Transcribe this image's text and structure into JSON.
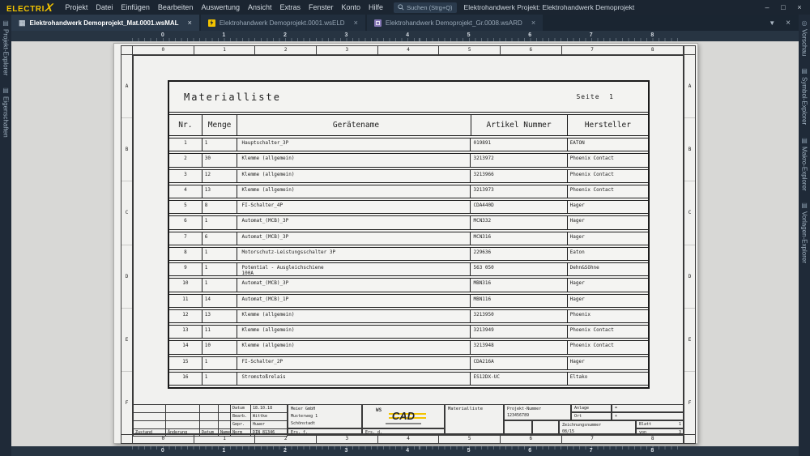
{
  "titlebar": {
    "logo_main": "ELECTRI",
    "logo_x": "X",
    "menus": [
      "Projekt",
      "Datei",
      "Einfügen",
      "Bearbeiten",
      "Auswertung",
      "Ansicht",
      "Extras",
      "Fenster",
      "Konto",
      "Hilfe"
    ],
    "search_placeholder": "Suchen (Strg+Q)",
    "window_title": "Elektrohandwerk  Projekt: Elektrohandwerk Demoprojekt",
    "minimize": "–",
    "maximize": "□",
    "close": "×"
  },
  "tabbar": {
    "tabs": [
      {
        "label": "Elektrohandwerk Demoprojekt_Mat.0001.wsMAL"
      },
      {
        "label": "Elektrohandwerk Demoprojekt.0001.wsELD"
      },
      {
        "label": "Elektrohandwerk Demoprojekt_Gr.0008.wsARD"
      }
    ],
    "close_glyph": "×",
    "dropdown_glyph": "▼"
  },
  "left_rail": {
    "items": [
      {
        "label": "Projekt-Explorer"
      },
      {
        "label": "Eigenschaften"
      }
    ]
  },
  "right_rail": {
    "items": [
      {
        "label": "Vorschau"
      },
      {
        "label": "Symbol-Explorer"
      },
      {
        "label": "Makro-Explorer"
      },
      {
        "label": "Vorlagen-Explorer"
      }
    ]
  },
  "rulers": {
    "numbers": [
      "0",
      "1",
      "2",
      "3",
      "4",
      "5",
      "6",
      "7",
      "8"
    ],
    "letters": [
      "A",
      "B",
      "C",
      "D",
      "E",
      "F"
    ]
  },
  "document": {
    "title": "Materialliste",
    "page_label": "Seite",
    "page_number": "1",
    "columns": [
      "Nr.",
      "Menge",
      "Gerätename",
      "Artikel Nummer",
      "Hersteller"
    ],
    "rows": [
      {
        "nr": "1",
        "menge": "1",
        "name": "Hauptschalter_3P",
        "name2": "",
        "artikel": "019891",
        "hersteller": "EATON"
      },
      {
        "nr": "2",
        "menge": "30",
        "name": "Klemme (allgemein)",
        "name2": "",
        "artikel": "3213972",
        "hersteller": "Phoenix Contact"
      },
      {
        "nr": "3",
        "menge": "12",
        "name": "Klemme (allgemein)",
        "name2": "",
        "artikel": "3213966",
        "hersteller": "Phoenix Contact"
      },
      {
        "nr": "4",
        "menge": "13",
        "name": "Klemme (allgemein)",
        "name2": "",
        "artikel": "3213973",
        "hersteller": "Phoenix Contact"
      },
      {
        "nr": "5",
        "menge": "8",
        "name": "FI-Schalter_4P",
        "name2": "",
        "artikel": "CDA440D",
        "hersteller": "Hager"
      },
      {
        "nr": "6",
        "menge": "1",
        "name": "Automat_(MCB)_3P",
        "name2": "",
        "artikel": "MCN332",
        "hersteller": "Hager"
      },
      {
        "nr": "7",
        "menge": "6",
        "name": "Automat_(MCB)_3P",
        "name2": "",
        "artikel": "MCN316",
        "hersteller": "Hager"
      },
      {
        "nr": "8",
        "menge": "1",
        "name": "Motorschutz-Leistungsschalter 3P",
        "name2": "",
        "artikel": "229636",
        "hersteller": "Eaton"
      },
      {
        "nr": "9",
        "menge": "1",
        "name": "Potential - Ausgleichschiene",
        "name2": "100A",
        "artikel": "563 050",
        "hersteller": "Dehn&Söhne"
      },
      {
        "nr": "10",
        "menge": "1",
        "name": "Automat_(MCB)_3P",
        "name2": "",
        "artikel": "MBN316",
        "hersteller": "Hager"
      },
      {
        "nr": "11",
        "menge": "14",
        "name": "Automat_(MCB)_1P",
        "name2": "",
        "artikel": "MBN116",
        "hersteller": "Hager"
      },
      {
        "nr": "12",
        "menge": "13",
        "name": "Klemme (allgemein)",
        "name2": "",
        "artikel": "3213950",
        "hersteller": "Phoenix"
      },
      {
        "nr": "13",
        "menge": "11",
        "name": "Klemme (allgemein)",
        "name2": "",
        "artikel": "3213949",
        "hersteller": "Phoenix Contact"
      },
      {
        "nr": "14",
        "menge": "10",
        "name": "Klemme (allgemein)",
        "name2": "",
        "artikel": "3213948",
        "hersteller": "Phoenix Contact"
      },
      {
        "nr": "15",
        "menge": "1",
        "name": "FI-Schalter_2P",
        "name2": "",
        "artikel": "CDA216A",
        "hersteller": "Hager"
      },
      {
        "nr": "16",
        "menge": "1",
        "name": "Stromstoßrelais",
        "name2": "",
        "artikel": "ES12DX-UC",
        "hersteller": "Eltako"
      }
    ]
  },
  "title_block": {
    "revision": {
      "zustand": "Zustand",
      "aenderung": "Änderung",
      "datum": "Datum",
      "name": "Name"
    },
    "approval": {
      "datum_label": "Datum",
      "datum": "18.10.18",
      "bearb_label": "Bearb.",
      "bearb": "Wittke",
      "gepr_label": "Gepr.",
      "gepr": "Huwer",
      "norm_label": "Norm",
      "norm": "DIN 81346"
    },
    "company": {
      "line1": "Meier GmbH",
      "line2": "Musterweg 1",
      "line3": "Schönstadt"
    },
    "ers_f": "Ers. f.",
    "ers_d": "Ers. d.",
    "logo": {
      "ws": "WS",
      "cad": "CAD"
    },
    "doc_type": "Materialliste",
    "projekt": {
      "label": "Projekt-Nummer",
      "value": "123456789"
    },
    "anlage": {
      "label": "Anlage",
      "value": "="
    },
    "ort": {
      "label": "Ort",
      "value": "+"
    },
    "zeichnung": {
      "label": "Zeichnungsnummer",
      "value": "08/15"
    },
    "blatt": {
      "label": "Blatt",
      "value": "1"
    },
    "von": {
      "label": "von",
      "value": "3"
    }
  }
}
